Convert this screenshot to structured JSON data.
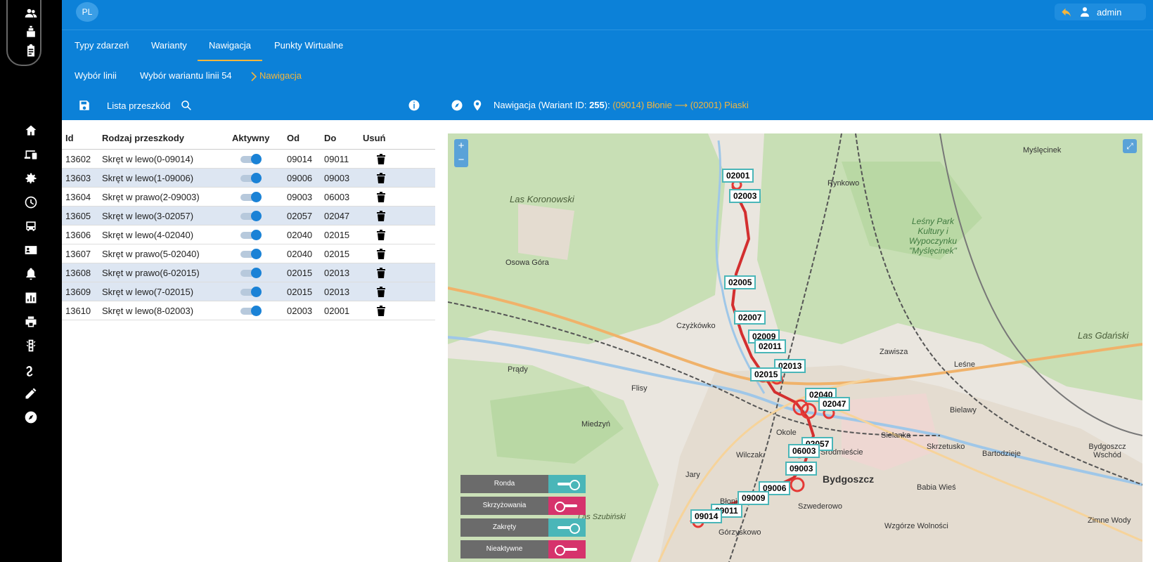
{
  "topbar": {
    "lang": "PL",
    "user": "admin"
  },
  "tabs": [
    {
      "label": "Typy zdarzeń",
      "active": false
    },
    {
      "label": "Warianty",
      "active": false
    },
    {
      "label": "Nawigacja",
      "active": true
    },
    {
      "label": "Punkty Wirtualne",
      "active": false
    }
  ],
  "breadcrumb": {
    "item1": "Wybór linii",
    "item2": "Wybór wariantu linii 54",
    "current": "Nawigacja"
  },
  "toolbar": {
    "list_label": "Lista przeszkód",
    "nav_prefix": "Nawigacja (Wariant ID: ",
    "variant_id": "255",
    "nav_suffix": "):",
    "route": "(09014) Błonie ⟶ (02001) Piaski"
  },
  "table": {
    "headers": [
      "Id",
      "Rodzaj przeszkody",
      "Aktywny",
      "Od",
      "Do",
      "Usuń"
    ],
    "rows": [
      {
        "id": "13602",
        "type": "Skręt w lewo(0-09014)",
        "od": "09014",
        "do": "09011"
      },
      {
        "id": "13603",
        "type": "Skręt w lewo(1-09006)",
        "od": "09006",
        "do": "09003"
      },
      {
        "id": "13604",
        "type": "Skręt w prawo(2-09003)",
        "od": "09003",
        "do": "06003"
      },
      {
        "id": "13605",
        "type": "Skręt w lewo(3-02057)",
        "od": "02057",
        "do": "02047"
      },
      {
        "id": "13606",
        "type": "Skręt w lewo(4-02040)",
        "od": "02040",
        "do": "02015"
      },
      {
        "id": "13607",
        "type": "Skręt w prawo(5-02040)",
        "od": "02040",
        "do": "02015"
      },
      {
        "id": "13608",
        "type": "Skręt w prawo(6-02015)",
        "od": "02015",
        "do": "02013"
      },
      {
        "id": "13609",
        "type": "Skręt w lewo(7-02015)",
        "od": "02015",
        "do": "02013"
      },
      {
        "id": "13610",
        "type": "Skręt w lewo(8-02003)",
        "od": "02003",
        "do": "02001"
      }
    ]
  },
  "map": {
    "stops": [
      "02001",
      "02003",
      "02005",
      "02007",
      "02009",
      "02011",
      "02013",
      "02015",
      "02040",
      "02047",
      "02057",
      "06003",
      "09003",
      "09006",
      "09009",
      "09011",
      "09014"
    ],
    "places": [
      "Las Koronowski",
      "Rynkowo",
      "Myślęcinek",
      "Osowa Góra",
      "Czyżkówko",
      "Leśny Park Kultury i Wypoczynku \"Myślęcinek\"",
      "Las Gdański",
      "Zawisza",
      "Leśne",
      "Prądy",
      "Flisy",
      "Miedzyń",
      "Bielawy",
      "Okole",
      "Śródmieście",
      "Sielanka",
      "Skrzetusko",
      "Bartodzieje",
      "Wilczak",
      "Bydgoszcz",
      "Babia Wieś",
      "Szwederowo",
      "Jary",
      "Błonie",
      "Wzgórze Wolności",
      "Górzyskowo",
      "Zimne Wody",
      "Bydgoszcz Wschód",
      "Las Szubiński"
    ],
    "legend": [
      {
        "label": "Ronda",
        "color": "#4ab6b8",
        "on": true
      },
      {
        "label": "Skrzyżowania",
        "color": "#d6336c",
        "on": false
      },
      {
        "label": "Zakręty",
        "color": "#4ab6b8",
        "on": true
      },
      {
        "label": "Nieaktywne",
        "color": "#d6336c",
        "on": false
      }
    ]
  }
}
